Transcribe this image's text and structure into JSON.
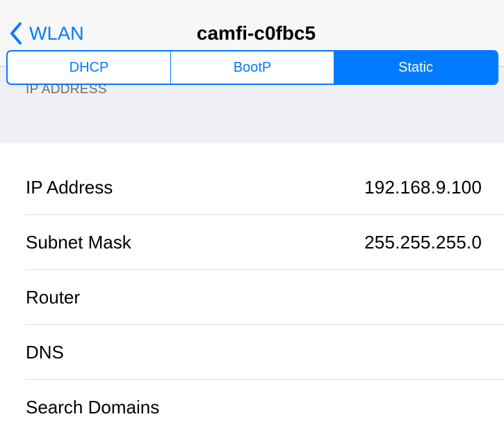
{
  "navbar": {
    "back_label": "WLAN",
    "title": "camfi-c0fbc5"
  },
  "section": {
    "header": "IP ADDRESS"
  },
  "segmented": {
    "options": [
      "DHCP",
      "BootP",
      "Static"
    ],
    "selected": "Static"
  },
  "fields": [
    {
      "label": "IP Address",
      "value": "192.168.9.100"
    },
    {
      "label": "Subnet Mask",
      "value": "255.255.255.0"
    },
    {
      "label": "Router",
      "value": ""
    },
    {
      "label": "DNS",
      "value": ""
    },
    {
      "label": "Search Domains",
      "value": ""
    }
  ],
  "colors": {
    "accent": "#007aff",
    "grouped_background": "#efeff4",
    "navbar_background": "#f7f7f7",
    "section_text": "#6d6d72"
  },
  "icons": {
    "back": "chevron-left-icon"
  }
}
